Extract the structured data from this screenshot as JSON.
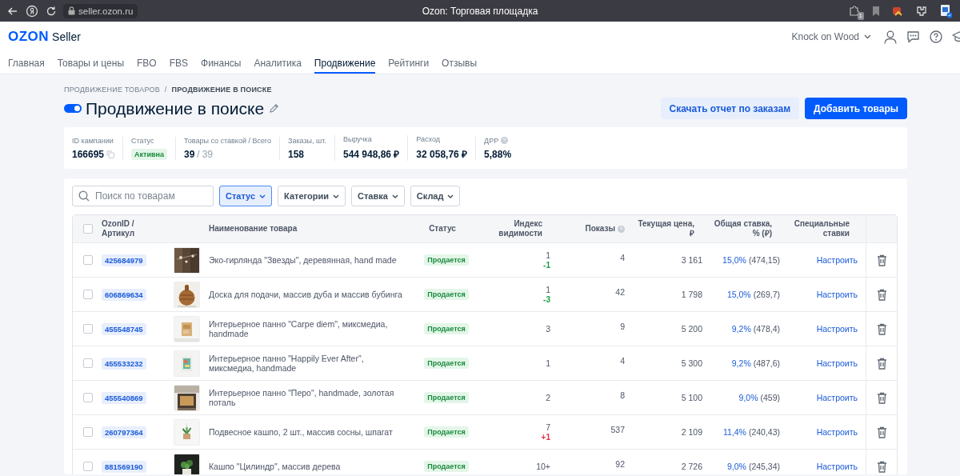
{
  "browser": {
    "url": "seller.ozon.ru",
    "title": "Ozon: Торговая площадка",
    "extension_badge": "1"
  },
  "header": {
    "logo": "OZON",
    "logo_suffix": "Seller",
    "account": "Knock on Wood"
  },
  "nav": [
    {
      "label": "Главная",
      "selected": false
    },
    {
      "label": "Товары и цены",
      "selected": false
    },
    {
      "label": "FBO",
      "selected": false
    },
    {
      "label": "FBS",
      "selected": false
    },
    {
      "label": "Финансы",
      "selected": false
    },
    {
      "label": "Аналитика",
      "selected": false
    },
    {
      "label": "Продвижение",
      "selected": true
    },
    {
      "label": "Рейтинги",
      "selected": false
    },
    {
      "label": "Отзывы",
      "selected": false
    }
  ],
  "breadcrumbs": [
    "ПРОДВИЖЕНИЕ ТОВАРОВ",
    "ПРОДВИЖЕНИЕ В ПОИСКЕ"
  ],
  "breadcrumb_separator": "/",
  "campaign": {
    "title": "Продвижение в поиске",
    "on": true
  },
  "buttons": [
    {
      "label": "Скачать отчет по заказам",
      "kind": "secondary"
    },
    {
      "label": "Добавить товары",
      "kind": "primary"
    }
  ],
  "stats": [
    {
      "label": "ID кампании",
      "value": "166695",
      "kind": "id"
    },
    {
      "label": "Статус",
      "value": "Активна",
      "kind": "badge"
    },
    {
      "label": "Товары со ставкой / Всего",
      "value": "39",
      "separator": "/",
      "total": "39",
      "kind": "ratio"
    },
    {
      "label": "Заказы, шт.",
      "value": "158",
      "kind": "plain"
    },
    {
      "label": "Выручка",
      "value": "544 948,86 ₽",
      "kind": "plain"
    },
    {
      "label": "Расход",
      "value": "32 058,76 ₽",
      "kind": "plain"
    },
    {
      "label": "ДРР",
      "value": "5,88%",
      "kind": "help"
    }
  ],
  "search": {
    "placeholder": "Поиск по товарам"
  },
  "filters": [
    {
      "label": "Статус",
      "selected": true
    },
    {
      "label": "Категории",
      "selected": false
    },
    {
      "label": "Ставка",
      "selected": false
    },
    {
      "label": "Склад",
      "selected": false
    }
  ],
  "table": {
    "header_checked": false,
    "columns": [
      "OzonID / Артикул",
      "Наименование товара",
      "Статус",
      "Индекс видимости",
      "Показы",
      "Текущая цена, ₽",
      "Общая ставка, % (₽)",
      "Специальные ставки"
    ],
    "rows": [
      {
        "checked": false,
        "id": "425684979",
        "name": "Эко-гирлянда \"Звезды\", деревянная, hand made",
        "status": "Продается",
        "index": "1",
        "index_change": "-1",
        "color": "#1b9c44",
        "shows": "4",
        "price": "3 161",
        "rate_percent": "15,0%",
        "rate_rub": "(474,15)",
        "action": "Настроить"
      },
      {
        "checked": false,
        "id": "606869634",
        "name": "Доска для подачи, массив дуба и массив бубинга",
        "status": "Продается",
        "index": "1",
        "index_change": "-3",
        "color": "#1b9c44",
        "shows": "42",
        "price": "1 798",
        "rate_percent": "15,0%",
        "rate_rub": "(269,7)",
        "action": "Настроить"
      },
      {
        "checked": false,
        "id": "455548745",
        "name": "Интерьерное панно \"Carpe diem\", миксмедиа, handmade",
        "status": "Продается",
        "index": "3",
        "shows": "9",
        "price": "5 200",
        "rate_percent": "9,2%",
        "rate_rub": "(478,4)",
        "action": "Настроить"
      },
      {
        "checked": false,
        "id": "455533232",
        "name": "Интерьерное панно \"Happily Ever After\", миксмедиа, handmade",
        "status": "Продается",
        "index": "1",
        "shows": "4",
        "price": "5 300",
        "rate_percent": "9,2%",
        "rate_rub": "(487,6)",
        "action": "Настроить"
      },
      {
        "checked": false,
        "id": "455540869",
        "name": "Интерьерное панно \"Перо\", handmade, золотая поталь",
        "status": "Продается",
        "index": "2",
        "shows": "8",
        "price": "5 100",
        "rate_percent": "9,0%",
        "rate_rub": "(459)",
        "action": "Настроить"
      },
      {
        "checked": false,
        "id": "260797364",
        "name": "Подвесное кашпо, 2 шт., массив сосны, шпагат",
        "status": "Продается",
        "index": "7",
        "index_change": "+1",
        "color": "#e0334b",
        "shows": "537",
        "price": "2 109",
        "rate_percent": "11,4%",
        "rate_rub": "(240,43)",
        "action": "Настроить"
      },
      {
        "checked": false,
        "id": "881569190",
        "name": "Кашпо \"Цилиндр\", массив дерева",
        "status": "Продается",
        "index": "10+",
        "shows": "92",
        "price": "2 726",
        "rate_percent": "9,0%",
        "rate_rub": "(245,34)",
        "action": "Настроить"
      }
    ]
  }
}
